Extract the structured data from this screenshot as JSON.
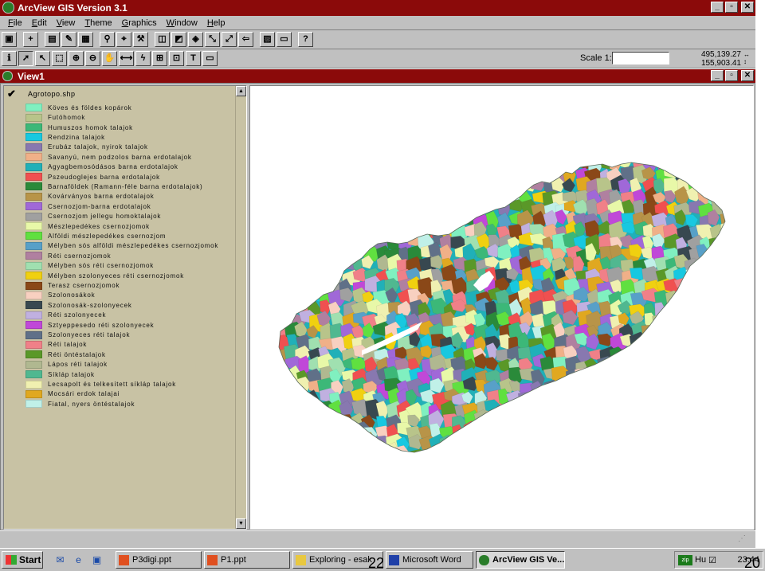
{
  "app": {
    "title": "ArcView GIS Version 3.1",
    "window_buttons": [
      "_",
      "▫",
      "✕"
    ]
  },
  "menu": {
    "items": [
      {
        "key": "F",
        "rest": "ile"
      },
      {
        "key": "E",
        "rest": "dit"
      },
      {
        "key": "V",
        "rest": "iew"
      },
      {
        "key": "T",
        "rest": "heme"
      },
      {
        "key": "G",
        "rest": "raphics"
      },
      {
        "key": "W",
        "rest": "indow"
      },
      {
        "key": "H",
        "rest": "elp"
      }
    ]
  },
  "toolbar": {
    "buttons": [
      "save-icon",
      "add-theme-icon",
      "theme-properties-icon",
      "edit-legend-icon",
      "open-table-icon",
      "find-icon",
      "locate-address-icon",
      "query-builder-icon",
      "zoom-full-icon",
      "zoom-active-icon",
      "zoom-selected-icon",
      "zoom-in-fixed-icon",
      "zoom-out-fixed-icon",
      "zoom-previous-icon",
      "select-graphics-icon",
      "clear-selection-icon",
      "help-icon"
    ]
  },
  "tools": {
    "buttons": [
      "identify-icon",
      "pointer-icon",
      "vertex-edit-icon",
      "select-feature-icon",
      "zoom-in-icon",
      "zoom-out-icon",
      "pan-icon",
      "measure-icon",
      "hotlink-icon",
      "area-of-interest-icon",
      "label-icon",
      "text-icon",
      "draw-icon"
    ],
    "scale_label": "Scale 1:",
    "scale_value": "",
    "coord_x": "495,139.27",
    "coord_y": "155,903.41"
  },
  "view": {
    "title": "View1",
    "window_buttons": [
      "_",
      "▫",
      "✕"
    ]
  },
  "theme": {
    "name": "Agrotopo.shp",
    "checked": "✔",
    "legend": [
      {
        "label": "Köves és földes kopárok",
        "color": "#80f0c0"
      },
      {
        "label": "Futóhomok",
        "color": "#b8c48a"
      },
      {
        "label": "Humuszos homok talajok",
        "color": "#3cb878"
      },
      {
        "label": "Rendzina talajok",
        "color": "#18c8e0"
      },
      {
        "label": "Erubáz talajok, nyirok talajok",
        "color": "#8878b0"
      },
      {
        "label": "Savanyú, nem podzolos barna erdotalajok",
        "color": "#f0b088"
      },
      {
        "label": "Agyagbemosódásos barna erdotalajok",
        "color": "#20b0b8"
      },
      {
        "label": "Pszeudoglejes barna erdotalajok",
        "color": "#f05050"
      },
      {
        "label": "Barnaföldek (Ramann-féle barna erdotalajok)",
        "color": "#2a8a3a"
      },
      {
        "label": "Kovárványos barna erdotalajok",
        "color": "#b89448"
      },
      {
        "label": "Csernozjom-barna erdotalajok",
        "color": "#a068d8"
      },
      {
        "label": "Csernozjom jellegu homoktalajok",
        "color": "#a0a0a0"
      },
      {
        "label": "Mészlepedékes csernozjomok",
        "color": "#e8f8a8"
      },
      {
        "label": "Alföldi mészlepedékes csernozjom",
        "color": "#60e040"
      },
      {
        "label": "Mélyben sós alföldi mészlepedékes csernozjomok",
        "color": "#58a0c8"
      },
      {
        "label": "Réti csernozjomok",
        "color": "#b080a0"
      },
      {
        "label": "Mélyben sós réti csernozjomok",
        "color": "#a0e0b0"
      },
      {
        "label": "Mélyben szolonyeces réti csernozjomok",
        "color": "#f0d010"
      },
      {
        "label": "Terasz csernozjomok",
        "color": "#8a4818"
      },
      {
        "label": "Szolonosákok",
        "color": "#f8d0c0"
      },
      {
        "label": "Szolonosák-szolonyecek",
        "color": "#384850"
      },
      {
        "label": "Réti szolonyecek",
        "color": "#c0b0e0"
      },
      {
        "label": "Sztyeppesedo réti szolonyecek",
        "color": "#c048d8"
      },
      {
        "label": "Szolonyeces réti talajok",
        "color": "#607088"
      },
      {
        "label": "Réti talajok",
        "color": "#f08088"
      },
      {
        "label": "Réti öntéstalajok",
        "color": "#5a9828"
      },
      {
        "label": "Lápos réti talajok",
        "color": "#b0b890"
      },
      {
        "label": "Síkláp talajok",
        "color": "#50b890"
      },
      {
        "label": "Lecsapolt és telkesített síkláp talajok",
        "color": "#f0f0b0"
      },
      {
        "label": "Mocsári erdok talajai",
        "color": "#e0a820"
      },
      {
        "label": "Fiatal, nyers öntéstalajok",
        "color": "#c0f0e8"
      }
    ]
  },
  "taskbar": {
    "start_label": "Start",
    "tasks": [
      {
        "label": "P3digi.ppt",
        "active": false
      },
      {
        "label": "P1.ppt",
        "active": false
      },
      {
        "label": "Exploring - esak",
        "active": false
      },
      {
        "label": "Microsoft Word",
        "active": false
      },
      {
        "label": "ArcView GIS Ve...",
        "active": true
      }
    ],
    "tray_icon_label": "zip",
    "tray_lang": "Hu",
    "clock": "23:44"
  },
  "slide": {
    "left_number": "22",
    "right_number": "20"
  }
}
